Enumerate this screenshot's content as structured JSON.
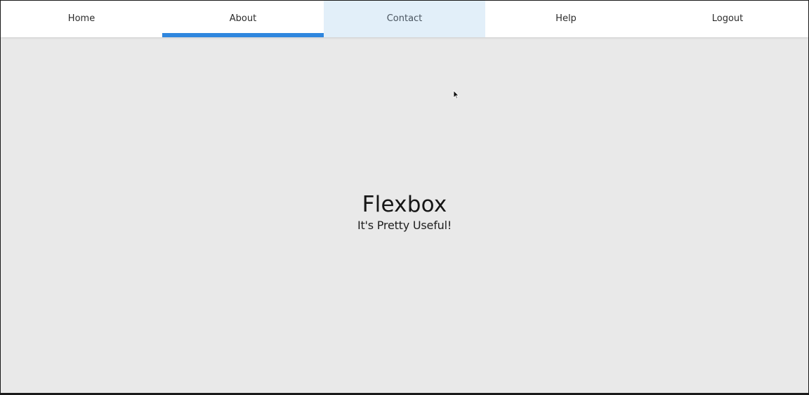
{
  "nav": {
    "items": [
      {
        "label": "Home"
      },
      {
        "label": "About"
      },
      {
        "label": "Contact"
      },
      {
        "label": "Help"
      },
      {
        "label": "Logout"
      }
    ],
    "active_item": "About",
    "hovered_item": "Contact"
  },
  "hero": {
    "title": "Flexbox",
    "subtitle": "It's Pretty Useful!"
  },
  "colors": {
    "accent": "#2f86de",
    "hover_bg": "#e2eff9",
    "page_bg": "#e9e9e9",
    "nav_bg": "#ffffff"
  },
  "icons": {
    "cursor": "mouse-pointer-icon"
  }
}
